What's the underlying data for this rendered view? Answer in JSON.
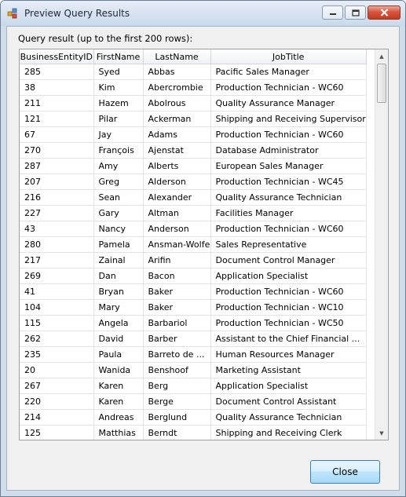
{
  "window": {
    "title": "Preview Query Results"
  },
  "label": "Query result (up to the first 200 rows):",
  "table": {
    "columns": [
      "BusinessEntityID",
      "FirstName",
      "LastName",
      "JobTitle"
    ],
    "rows": [
      [
        "285",
        "Syed",
        "Abbas",
        "Pacific Sales Manager"
      ],
      [
        "38",
        "Kim",
        "Abercrombie",
        "Production Technician - WC60"
      ],
      [
        "211",
        "Hazem",
        "Abolrous",
        "Quality Assurance Manager"
      ],
      [
        "121",
        "Pilar",
        "Ackerman",
        "Shipping and Receiving Supervisor"
      ],
      [
        "67",
        "Jay",
        "Adams",
        "Production Technician - WC60"
      ],
      [
        "270",
        "François",
        "Ajenstat",
        "Database Administrator"
      ],
      [
        "287",
        "Amy",
        "Alberts",
        "European Sales Manager"
      ],
      [
        "207",
        "Greg",
        "Alderson",
        "Production Technician - WC45"
      ],
      [
        "216",
        "Sean",
        "Alexander",
        "Quality Assurance Technician"
      ],
      [
        "227",
        "Gary",
        "Altman",
        "Facilities Manager"
      ],
      [
        "43",
        "Nancy",
        "Anderson",
        "Production Technician - WC60"
      ],
      [
        "280",
        "Pamela",
        "Ansman-Wolfe",
        "Sales Representative"
      ],
      [
        "217",
        "Zainal",
        "Arifin",
        "Document Control Manager"
      ],
      [
        "269",
        "Dan",
        "Bacon",
        "Application Specialist"
      ],
      [
        "41",
        "Bryan",
        "Baker",
        "Production Technician - WC60"
      ],
      [
        "104",
        "Mary",
        "Baker",
        "Production Technician - WC10"
      ],
      [
        "115",
        "Angela",
        "Barbariol",
        "Production Technician - WC50"
      ],
      [
        "262",
        "David",
        "Barber",
        "Assistant to the Chief Financial ..."
      ],
      [
        "235",
        "Paula",
        "Barreto de ...",
        "Human Resources Manager"
      ],
      [
        "20",
        "Wanida",
        "Benshoof",
        "Marketing Assistant"
      ],
      [
        "267",
        "Karen",
        "Berg",
        "Application Specialist"
      ],
      [
        "220",
        "Karen",
        "Berge",
        "Document Control Assistant"
      ],
      [
        "214",
        "Andreas",
        "Berglund",
        "Quality Assurance Technician"
      ],
      [
        "125",
        "Matthias",
        "Berndt",
        "Shipping and Receiving Clerk"
      ]
    ]
  },
  "buttons": {
    "close": "Close"
  },
  "icons": {
    "app": "query-results-icon",
    "minimize": "minimize-icon",
    "maximize": "maximize-icon",
    "close": "close-icon"
  }
}
